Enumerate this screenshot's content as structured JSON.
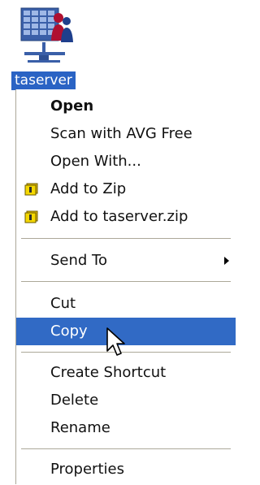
{
  "desktop_icon": {
    "label": "taserver",
    "icon": "network-users-icon"
  },
  "context_menu": {
    "items": [
      {
        "label": "Open",
        "bold": true
      },
      {
        "label": "Scan with AVG Free"
      },
      {
        "label": "Open With..."
      },
      {
        "label": "Add to Zip",
        "icon": "zip-archive-icon"
      },
      {
        "label": "Add to taserver.zip",
        "icon": "zip-archive-icon"
      },
      {
        "label": "Send To",
        "has_submenu": true
      },
      {
        "label": "Cut"
      },
      {
        "label": "Copy",
        "selected": true
      },
      {
        "label": "Create Shortcut"
      },
      {
        "label": "Delete"
      },
      {
        "label": "Rename"
      },
      {
        "label": "Properties"
      }
    ]
  },
  "colors": {
    "selection": "#316ac5",
    "icon_label_highlight": "#2a63c4",
    "separator": "#aca899"
  }
}
